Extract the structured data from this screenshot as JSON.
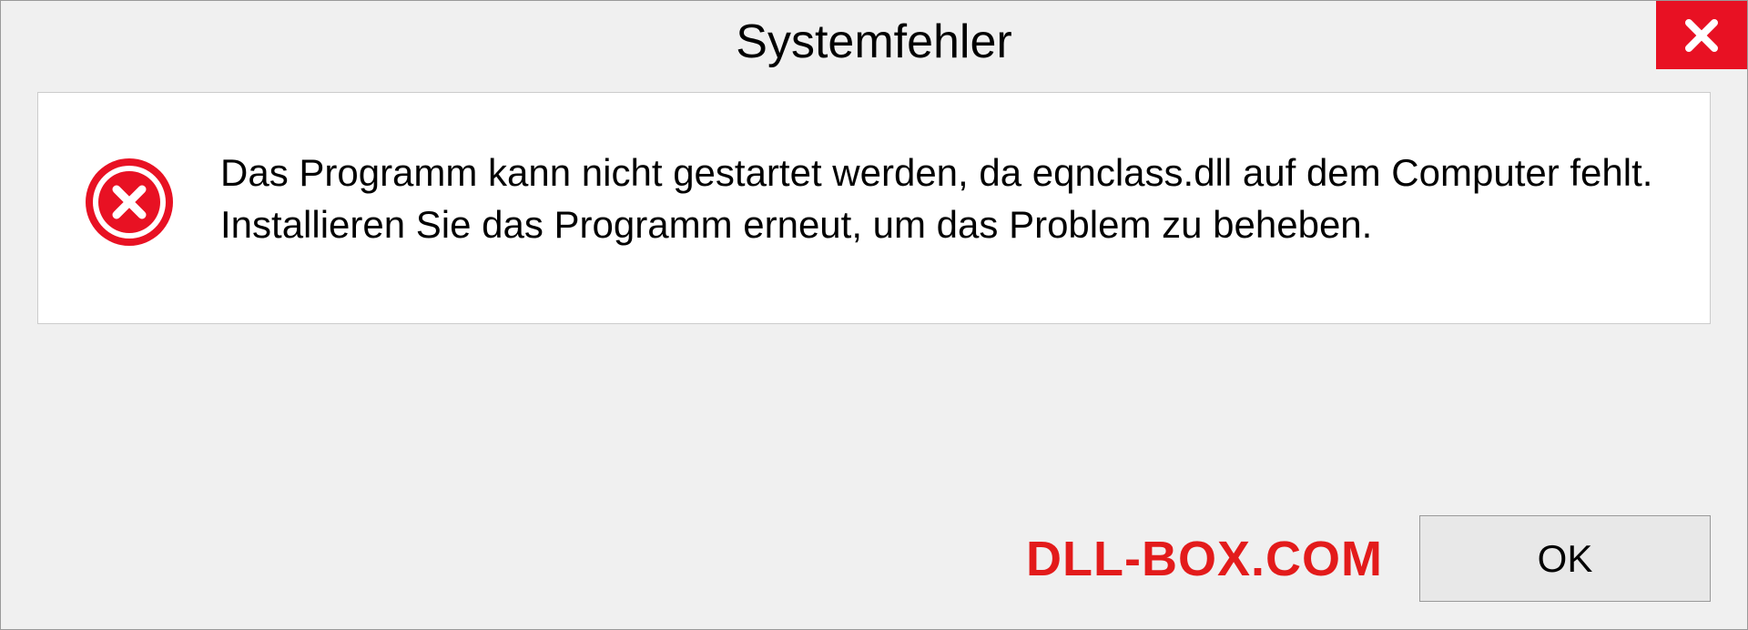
{
  "dialog": {
    "title": "Systemfehler",
    "message": "Das Programm kann nicht gestartet werden, da eqnclass.dll auf dem Computer fehlt. Installieren Sie das Programm erneut, um das Problem zu beheben.",
    "ok_label": "OK"
  },
  "watermark": "DLL-BOX.COM"
}
